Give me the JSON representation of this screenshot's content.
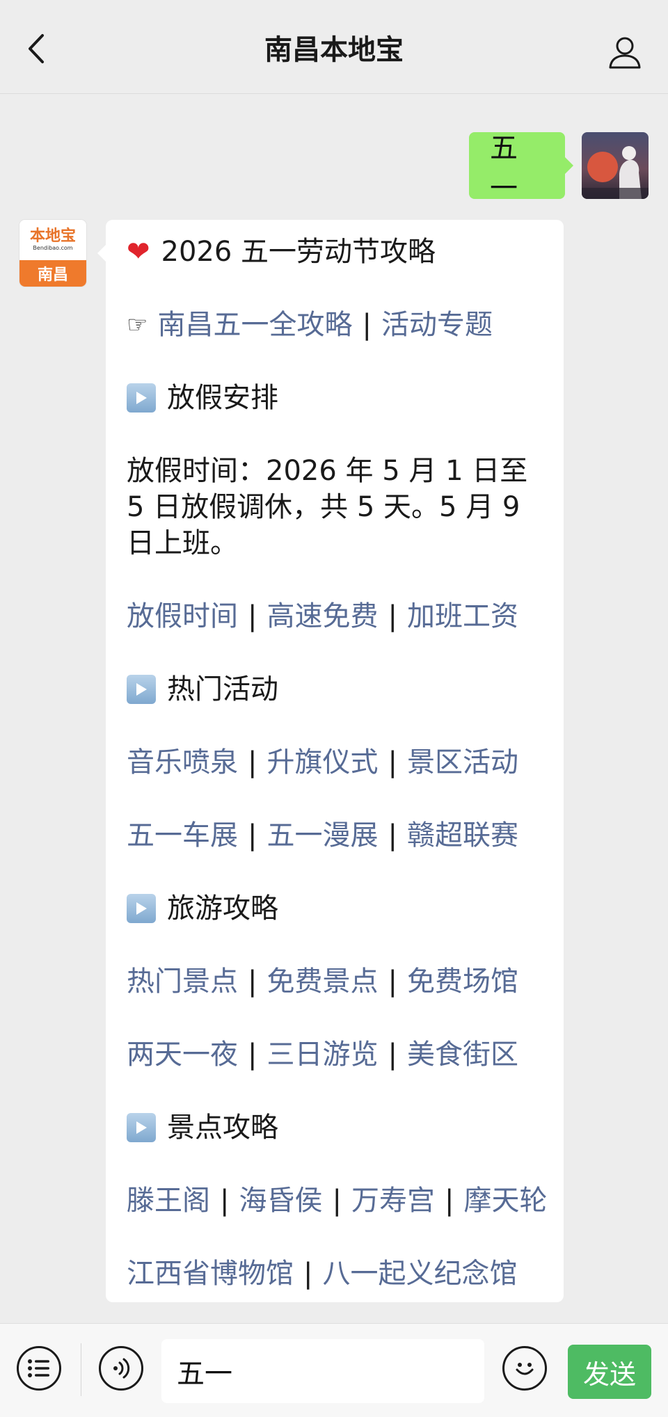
{
  "header": {
    "title": "南昌本地宝"
  },
  "outgoing": {
    "text": "五一"
  },
  "bot": {
    "avatar_brand": "本地宝",
    "avatar_domain": "Bendibao.com",
    "avatar_city": "南昌"
  },
  "message": {
    "heading": "2026 五一劳动节攻略",
    "top_links": [
      "南昌五一全攻略",
      "活动专题"
    ],
    "sections": [
      {
        "title": "放假安排"
      },
      {
        "title": "热门活动"
      },
      {
        "title": "旅游攻略"
      },
      {
        "title": "景点攻略"
      }
    ],
    "holiday_text": "放假时间：2026 年 5 月 1 日至 5 日放假调休，共 5 天。5 月 9 日上班。",
    "holiday_links": [
      "放假时间",
      "高速免费",
      "加班工资"
    ],
    "activity_links_1": [
      "音乐喷泉",
      "升旗仪式",
      "景区活动"
    ],
    "activity_links_2": [
      "五一车展",
      "五一漫展",
      "赣超联赛"
    ],
    "travel_links_1": [
      "热门景点",
      "免费景点",
      "免费场馆"
    ],
    "travel_links_2": [
      "两天一夜",
      "三日游览",
      "美食街区"
    ],
    "spot_links_1": [
      "滕王阁",
      "海昏侯",
      "万寿宫",
      "摩天轮"
    ],
    "spot_links_2": [
      "江西省博物馆",
      "八一起义纪念馆"
    ],
    "separator": "|"
  },
  "input_bar": {
    "value": "五一",
    "send_label": "发送"
  },
  "colors": {
    "link": "#576b95",
    "outgoing_bubble": "#95ec69",
    "send_button": "#4ebb63"
  }
}
